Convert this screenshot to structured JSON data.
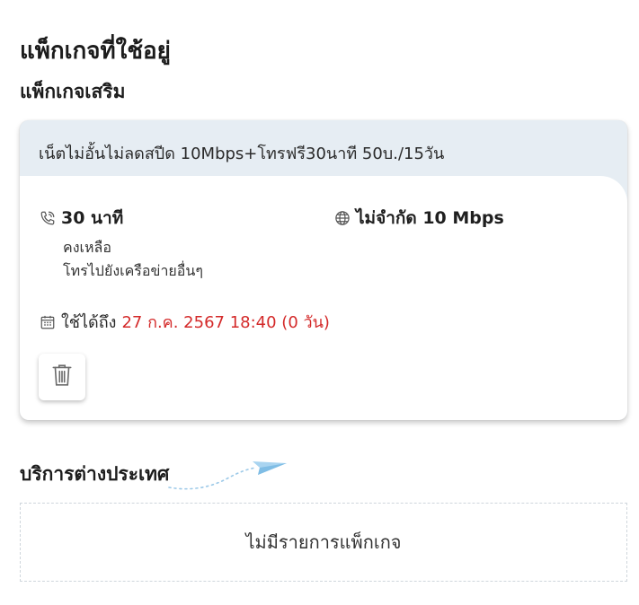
{
  "page": {
    "title": "แพ็กเกจที่ใช้อยู่"
  },
  "addon_section": {
    "title": "แพ็กเกจเสริม",
    "package": {
      "name": "เน็ตไม่อั้นไม่ลดสปีด 10Mbps+โทรฟรี30นาที 50บ./15วัน",
      "voice": {
        "icon": "phone-icon",
        "title": "30 นาที",
        "remaining": "คงเหลือ",
        "note": "โทรไปยังเครือข่ายอื่นๆ"
      },
      "data": {
        "icon": "globe-icon",
        "title": "ไม่จำกัด 10 Mbps"
      },
      "expiry": {
        "icon": "calendar-icon",
        "label": "ใช้ได้ถึง",
        "value": "27 ก.ค. 2567 18:40 (0 วัน)"
      },
      "delete_icon": "trash-icon"
    }
  },
  "international_section": {
    "title": "บริการต่างประเทศ",
    "decoration_icon": "paper-plane-icon",
    "empty_text": "ไม่มีรายการแพ็กเกจ"
  },
  "colors": {
    "header_bg": "#e6edf3",
    "expiry_red": "#d42a2a",
    "plane_blue": "#8ec6ea"
  }
}
